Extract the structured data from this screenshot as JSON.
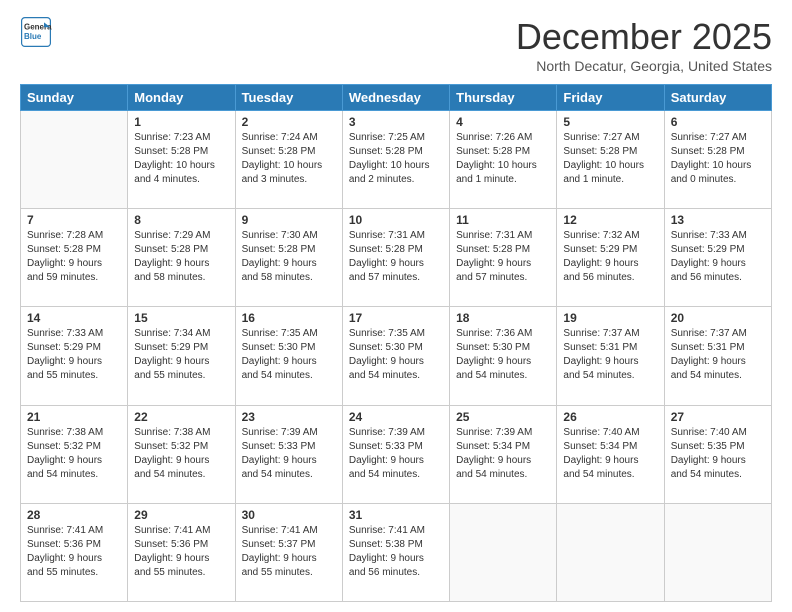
{
  "header": {
    "logo_line1": "General",
    "logo_line2": "Blue",
    "month": "December 2025",
    "location": "North Decatur, Georgia, United States"
  },
  "weekdays": [
    "Sunday",
    "Monday",
    "Tuesday",
    "Wednesday",
    "Thursday",
    "Friday",
    "Saturday"
  ],
  "weeks": [
    [
      {
        "day": "",
        "info": ""
      },
      {
        "day": "1",
        "info": "Sunrise: 7:23 AM\nSunset: 5:28 PM\nDaylight: 10 hours\nand 4 minutes."
      },
      {
        "day": "2",
        "info": "Sunrise: 7:24 AM\nSunset: 5:28 PM\nDaylight: 10 hours\nand 3 minutes."
      },
      {
        "day": "3",
        "info": "Sunrise: 7:25 AM\nSunset: 5:28 PM\nDaylight: 10 hours\nand 2 minutes."
      },
      {
        "day": "4",
        "info": "Sunrise: 7:26 AM\nSunset: 5:28 PM\nDaylight: 10 hours\nand 1 minute."
      },
      {
        "day": "5",
        "info": "Sunrise: 7:27 AM\nSunset: 5:28 PM\nDaylight: 10 hours\nand 1 minute."
      },
      {
        "day": "6",
        "info": "Sunrise: 7:27 AM\nSunset: 5:28 PM\nDaylight: 10 hours\nand 0 minutes."
      }
    ],
    [
      {
        "day": "7",
        "info": "Sunrise: 7:28 AM\nSunset: 5:28 PM\nDaylight: 9 hours\nand 59 minutes."
      },
      {
        "day": "8",
        "info": "Sunrise: 7:29 AM\nSunset: 5:28 PM\nDaylight: 9 hours\nand 58 minutes."
      },
      {
        "day": "9",
        "info": "Sunrise: 7:30 AM\nSunset: 5:28 PM\nDaylight: 9 hours\nand 58 minutes."
      },
      {
        "day": "10",
        "info": "Sunrise: 7:31 AM\nSunset: 5:28 PM\nDaylight: 9 hours\nand 57 minutes."
      },
      {
        "day": "11",
        "info": "Sunrise: 7:31 AM\nSunset: 5:28 PM\nDaylight: 9 hours\nand 57 minutes."
      },
      {
        "day": "12",
        "info": "Sunrise: 7:32 AM\nSunset: 5:29 PM\nDaylight: 9 hours\nand 56 minutes."
      },
      {
        "day": "13",
        "info": "Sunrise: 7:33 AM\nSunset: 5:29 PM\nDaylight: 9 hours\nand 56 minutes."
      }
    ],
    [
      {
        "day": "14",
        "info": "Sunrise: 7:33 AM\nSunset: 5:29 PM\nDaylight: 9 hours\nand 55 minutes."
      },
      {
        "day": "15",
        "info": "Sunrise: 7:34 AM\nSunset: 5:29 PM\nDaylight: 9 hours\nand 55 minutes."
      },
      {
        "day": "16",
        "info": "Sunrise: 7:35 AM\nSunset: 5:30 PM\nDaylight: 9 hours\nand 54 minutes."
      },
      {
        "day": "17",
        "info": "Sunrise: 7:35 AM\nSunset: 5:30 PM\nDaylight: 9 hours\nand 54 minutes."
      },
      {
        "day": "18",
        "info": "Sunrise: 7:36 AM\nSunset: 5:30 PM\nDaylight: 9 hours\nand 54 minutes."
      },
      {
        "day": "19",
        "info": "Sunrise: 7:37 AM\nSunset: 5:31 PM\nDaylight: 9 hours\nand 54 minutes."
      },
      {
        "day": "20",
        "info": "Sunrise: 7:37 AM\nSunset: 5:31 PM\nDaylight: 9 hours\nand 54 minutes."
      }
    ],
    [
      {
        "day": "21",
        "info": "Sunrise: 7:38 AM\nSunset: 5:32 PM\nDaylight: 9 hours\nand 54 minutes."
      },
      {
        "day": "22",
        "info": "Sunrise: 7:38 AM\nSunset: 5:32 PM\nDaylight: 9 hours\nand 54 minutes."
      },
      {
        "day": "23",
        "info": "Sunrise: 7:39 AM\nSunset: 5:33 PM\nDaylight: 9 hours\nand 54 minutes."
      },
      {
        "day": "24",
        "info": "Sunrise: 7:39 AM\nSunset: 5:33 PM\nDaylight: 9 hours\nand 54 minutes."
      },
      {
        "day": "25",
        "info": "Sunrise: 7:39 AM\nSunset: 5:34 PM\nDaylight: 9 hours\nand 54 minutes."
      },
      {
        "day": "26",
        "info": "Sunrise: 7:40 AM\nSunset: 5:34 PM\nDaylight: 9 hours\nand 54 minutes."
      },
      {
        "day": "27",
        "info": "Sunrise: 7:40 AM\nSunset: 5:35 PM\nDaylight: 9 hours\nand 54 minutes."
      }
    ],
    [
      {
        "day": "28",
        "info": "Sunrise: 7:41 AM\nSunset: 5:36 PM\nDaylight: 9 hours\nand 55 minutes."
      },
      {
        "day": "29",
        "info": "Sunrise: 7:41 AM\nSunset: 5:36 PM\nDaylight: 9 hours\nand 55 minutes."
      },
      {
        "day": "30",
        "info": "Sunrise: 7:41 AM\nSunset: 5:37 PM\nDaylight: 9 hours\nand 55 minutes."
      },
      {
        "day": "31",
        "info": "Sunrise: 7:41 AM\nSunset: 5:38 PM\nDaylight: 9 hours\nand 56 minutes."
      },
      {
        "day": "",
        "info": ""
      },
      {
        "day": "",
        "info": ""
      },
      {
        "day": "",
        "info": ""
      }
    ]
  ]
}
